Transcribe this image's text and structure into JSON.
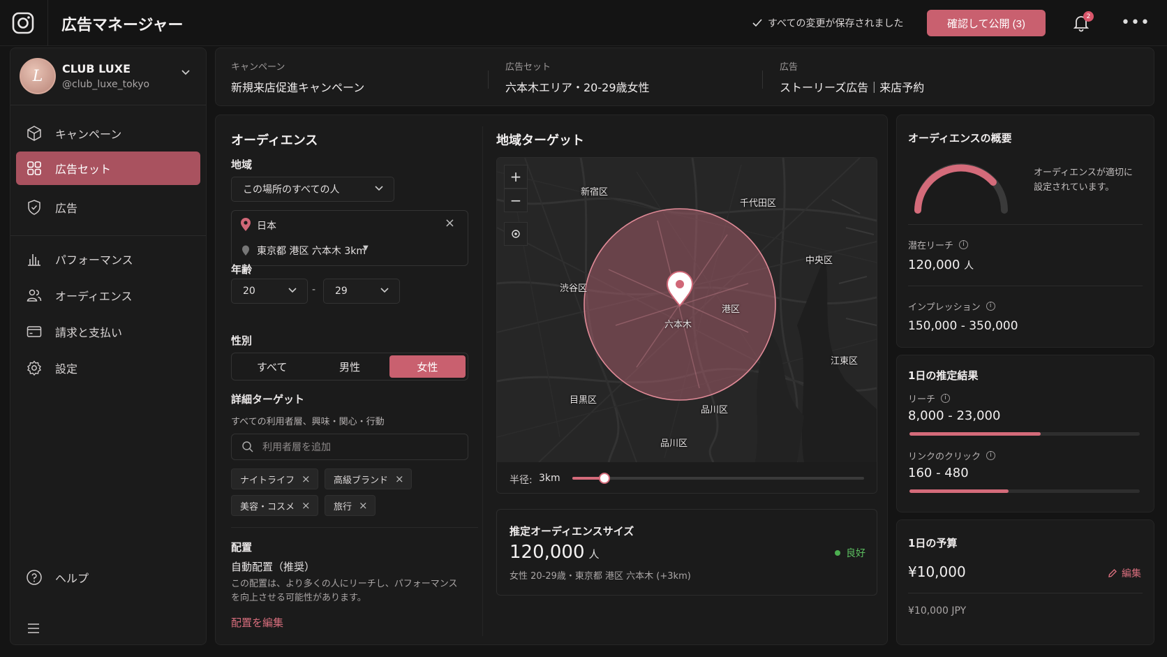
{
  "app": {
    "title": "広告マネージャー",
    "saved_status": "すべての変更が保存されました",
    "publish_label": "確認して公開 (3)",
    "notification_count": "2",
    "more_label": "•••"
  },
  "account": {
    "name": "CLUB LUXE",
    "handle": "@club_luxe_tokyo",
    "avatar_letter": "L"
  },
  "sidebar": {
    "items": [
      {
        "label": "キャンペーン",
        "icon": "cube-icon"
      },
      {
        "label": "広告セット",
        "icon": "grid-icon",
        "active": true
      },
      {
        "label": "広告",
        "icon": "badge-icon"
      },
      {
        "label": "パフォーマンス",
        "icon": "bar-chart-icon"
      },
      {
        "label": "オーディエンス",
        "icon": "users-icon"
      },
      {
        "label": "請求と支払い",
        "icon": "wallet-icon"
      },
      {
        "label": "設定",
        "icon": "gear-icon"
      }
    ],
    "help_label": "ヘルプ"
  },
  "breadcrumb": {
    "campaign_label": "キャンペーン",
    "campaign_value": "新規来店促進キャンペーン",
    "adset_label": "広告セット",
    "adset_value": "六本木エリア・20-29歳女性",
    "ad_label": "広告",
    "ad_value": "ストーリーズ広告｜来店予約"
  },
  "audience": {
    "title": "オーディエンス",
    "region_label": "地域",
    "region_select": "この場所のすべての人",
    "country": "日本",
    "location": "東京都 港区 六本木 3km",
    "age_label": "年齢",
    "age_min": "20",
    "age_sep": "-",
    "age_max": "29",
    "gender_label": "性別",
    "gender_options": [
      "すべて",
      "男性",
      "女性"
    ],
    "gender_selected": "女性",
    "detail_label": "詳細ターゲット",
    "detail_sub": "すべての利用者層、興味・関心・行動",
    "search_placeholder": "利用者層を追加",
    "chips": [
      "ナイトライフ",
      "高級ブランド",
      "美容・コスメ",
      "旅行"
    ],
    "placement_label": "配置",
    "placement_value": "自動配置（推奨）",
    "placement_desc": "この配置は、より多くの人にリーチし、パフォーマンスを向上させる可能性があります。",
    "placement_edit": "配置を編集"
  },
  "map": {
    "title": "地域ターゲット",
    "labels": {
      "shinjuku": "新宿区",
      "chiyoda": "千代田区",
      "chuo": "中央区",
      "shibuya": "渋谷区",
      "minato": "港区",
      "roppongi": "六本木",
      "koto": "江東区",
      "meguro": "目黒区",
      "shinagawa1": "品川区",
      "shinagawa2": "品川区"
    },
    "radius_label": "半径:",
    "radius_value": "3km",
    "radius_fraction": 0.11
  },
  "estimate": {
    "title": "推定オーディエンスサイズ",
    "value": "120,000",
    "unit": "人",
    "status": "良好",
    "detail": "女性 20-29歳・東京都 港区 六本木 (+3km)"
  },
  "summary": {
    "title": "オーディエンスの概要",
    "gauge_text": "オーディエンスが適切に設定されています。",
    "potential_reach_label": "潜在リーチ",
    "potential_reach_value": "120,000",
    "potential_reach_unit": "人",
    "impressions_label": "インプレッション",
    "impressions_value": "150,000 - 350,000"
  },
  "daily_results": {
    "title": "1日の推定結果",
    "reach_label": "リーチ",
    "reach_value": "8,000 - 23,000",
    "reach_fraction": 0.57,
    "clicks_label": "リンクのクリック",
    "clicks_value": "160 - 480",
    "clicks_fraction": 0.43
  },
  "budget": {
    "title": "1日の予算",
    "value": "¥10,000",
    "edit_label": "編集",
    "currency_note": "¥10,000 JPY"
  },
  "colors": {
    "accent": "#c9606f",
    "active_nav": "#a9525f",
    "good": "#4caf50"
  }
}
